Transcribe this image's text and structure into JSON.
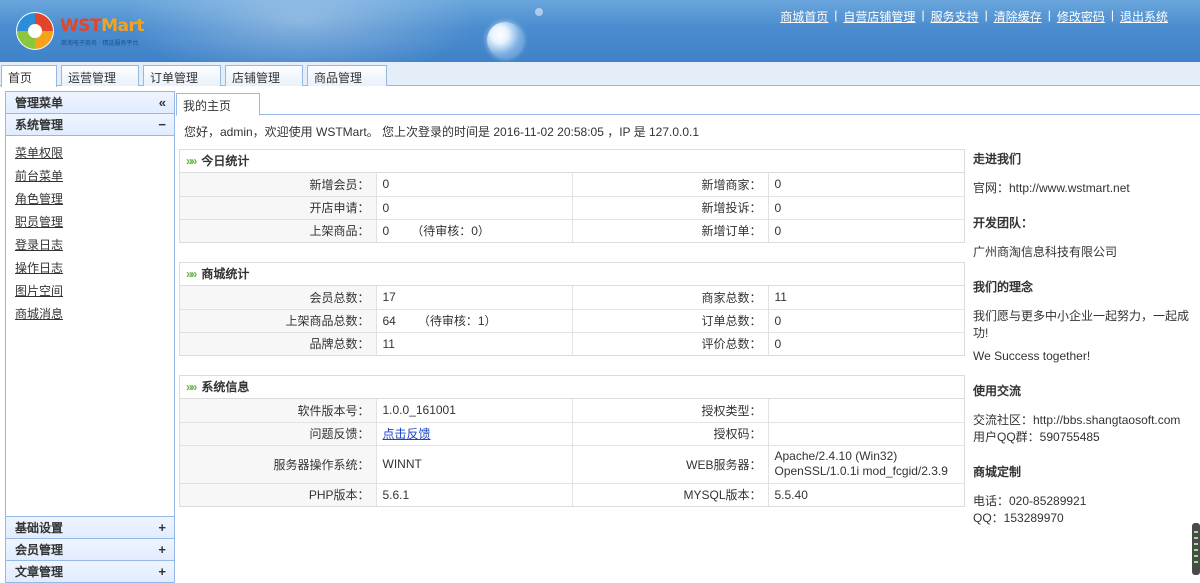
{
  "brand": {
    "logo_text_a": "WST",
    "logo_text_b": "Mart",
    "logo_sub": "商淘电子商务 · 精选服务平台"
  },
  "toplinks": [
    "商城首页",
    "自营店铺管理",
    "服务支持",
    "清除缓存",
    "修改密码",
    "退出系统"
  ],
  "topnav": {
    "tabs": [
      "首页",
      "运营管理",
      "订单管理",
      "店铺管理",
      "商品管理"
    ],
    "active": "首页"
  },
  "sidebar": {
    "header": "管理菜单",
    "collapse_glyph": "«",
    "group": "系统管理",
    "group_toggle": "−",
    "items": [
      "菜单权限",
      "前台菜单",
      "角色管理",
      "职员管理",
      "登录日志",
      "操作日志",
      "图片空间",
      "商城消息"
    ],
    "bottom_groups": [
      "基础设置",
      "会员管理",
      "文章管理"
    ],
    "expand_glyph": "+"
  },
  "main": {
    "tab": "我的主页",
    "welcome": "您好，admin，欢迎使用 WSTMart。 您上次登录的时间是 2016-11-02 20:58:05 ，IP 是 127.0.0.1"
  },
  "today": {
    "title": "今日统计",
    "rows": [
      {
        "l1": "新增会员：",
        "v1": "0",
        "p1": "",
        "l2": "新增商家：",
        "v2": "0"
      },
      {
        "l1": "开店申请：",
        "v1": "0",
        "p1": "",
        "l2": "新增投诉：",
        "v2": "0"
      },
      {
        "l1": "上架商品：",
        "v1": "0",
        "p1": "（待审核：0）",
        "l2": "新增订单：",
        "v2": "0"
      }
    ]
  },
  "mall": {
    "title": "商城统计",
    "rows": [
      {
        "l1": "会员总数：",
        "v1": "17",
        "p1": "",
        "l2": "商家总数：",
        "v2": "11"
      },
      {
        "l1": "上架商品总数：",
        "v1": "64",
        "p1": "（待审核：1）",
        "l2": "订单总数：",
        "v2": "0"
      },
      {
        "l1": "品牌总数：",
        "v1": "11",
        "p1": "",
        "l2": "评价总数：",
        "v2": "0"
      }
    ]
  },
  "sysinfo": {
    "title": "系统信息",
    "rows": [
      {
        "l1": "软件版本号：",
        "v1": "1.0.0_161001",
        "l2": "授权类型：",
        "v2": ""
      },
      {
        "l1": "问题反馈：",
        "v1": "点击反馈",
        "l2": "授权码：",
        "v2": ""
      },
      {
        "l1": "服务器操作系统：",
        "v1": "WINNT",
        "l2": "WEB服务器：",
        "v2a": "Apache/2.4.10 (Win32)",
        "v2b": "OpenSSL/1.0.1i mod_fcgid/2.3.9"
      },
      {
        "l1": "PHP版本：",
        "v1": "5.6.1",
        "l2": "MYSQL版本：",
        "v2": "5.5.40"
      }
    ]
  },
  "info": {
    "about_h": "走进我们",
    "about_p": "官网：http://www.wstmart.net",
    "team_h": "开发团队：",
    "team_p": "广州商淘信息科技有限公司",
    "idea_h": "我们的理念",
    "idea_p1": "我们愿与更多中小企业一起努力，一起成功!",
    "idea_p2": "We Success together!",
    "comm_h": "使用交流",
    "comm_p1": "交流社区：http://bbs.shangtaosoft.com",
    "comm_p2": "用户QQ群：590755485",
    "custom_h": "商城定制",
    "custom_p1": "电话：020-85289921",
    "custom_p2": "QQ：153289970"
  }
}
